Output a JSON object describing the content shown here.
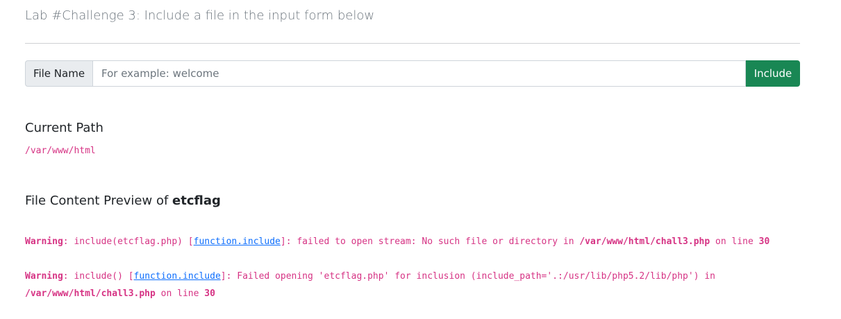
{
  "lab_title": "Lab #Challenge 3: Include a file in the input form below",
  "form": {
    "addon_label": "File Name",
    "input_placeholder": "For example: welcome",
    "input_value": "",
    "submit_label": "Include"
  },
  "current_path": {
    "heading": "Current Path",
    "value": "/var/www/html"
  },
  "preview": {
    "heading_prefix": "File Content Preview of",
    "filename": "etcflag"
  },
  "warnings": [
    {
      "label": "Warning",
      "text1": ": include(etcflag.php) [",
      "link": "function.include",
      "text2": "]: failed to open stream: No such file or directory in ",
      "file": "/var/www/html/chall3.php",
      "text3": " on line ",
      "line": "30"
    },
    {
      "label": "Warning",
      "text1": ": include() [",
      "link": "function.include",
      "text2": "]: Failed opening 'etcflag.php' for inclusion (include_path='.:/usr/lib/php5.2/lib/php') in ",
      "file": "/var/www/html/chall3.php",
      "text3": " on line ",
      "line": "30"
    }
  ],
  "colors": {
    "include_button": "#198754",
    "code_text": "#d63384",
    "link": "#0d6efd"
  }
}
